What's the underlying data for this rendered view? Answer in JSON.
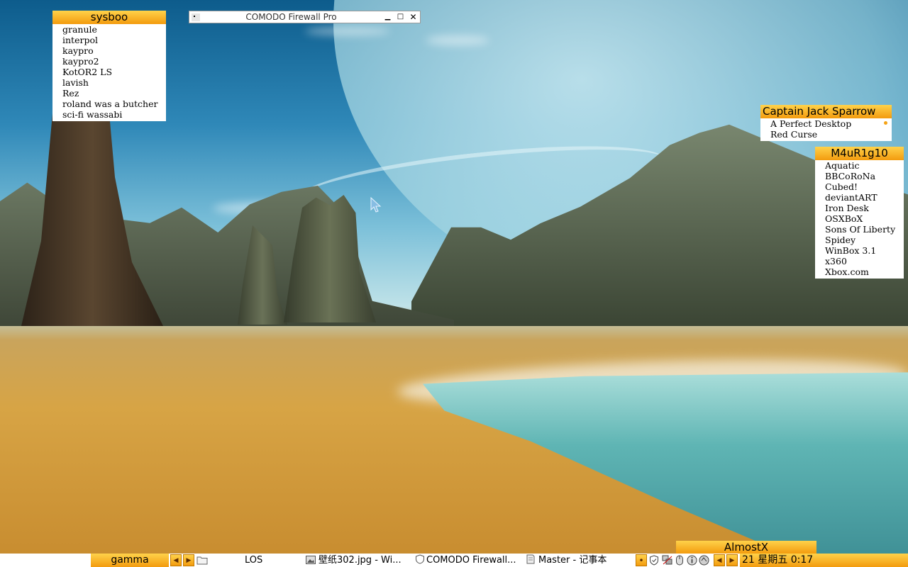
{
  "colors": {
    "accent_top": "#ffd24a",
    "accent_bottom": "#f39b0e",
    "panel_bg": "#ffffff"
  },
  "widgets": {
    "sysboo": {
      "title": "sysboo",
      "items": [
        "granule",
        "interpol",
        "kaypro",
        "kaypro2",
        "KotOR2 LS",
        "lavish",
        "Rez",
        "roland was a butcher",
        "sci-fi wassabi"
      ]
    },
    "captain": {
      "title": "Captain Jack Sparrow",
      "items": [
        "A Perfect Desktop",
        "Red Curse"
      ]
    },
    "m4ur": {
      "title": "M4uR1g10",
      "items": [
        "Aquatic",
        "BBCoRoNa",
        "Cubed!",
        "deviantART",
        "Iron Desk",
        "OSXBoX",
        "Sons Of Liberty",
        "Spidey",
        "WinBox 3.1",
        "x360",
        "Xbox.com"
      ]
    },
    "almostx": {
      "title": "AlmostX"
    }
  },
  "window": {
    "title": "COMODO Firewall Pro",
    "min_glyph": "▁",
    "max_glyph": "□",
    "close_glyph": "✕"
  },
  "taskbar": {
    "workspace": "gamma",
    "prev_glyph": "◀",
    "next_glyph": "▶",
    "folder_icon": "folder-icon",
    "items": [
      {
        "label": "LOS",
        "icon": ""
      },
      {
        "label": "壁纸302.jpg - Wi...",
        "icon": "image-viewer-icon"
      },
      {
        "label": "COMODO Firewall...",
        "icon": "shield-icon"
      },
      {
        "label": "Master - 记事本",
        "icon": "notepad-icon"
      }
    ],
    "tray": {
      "dot_glyph": "•",
      "icons": [
        "shield-tray-icon",
        "network-tray-icon",
        "mouse-tray-icon",
        "info-tray-icon",
        "app-tray-icon",
        "steam-tray-icon"
      ]
    },
    "clock": "21 星期五 0:17"
  }
}
